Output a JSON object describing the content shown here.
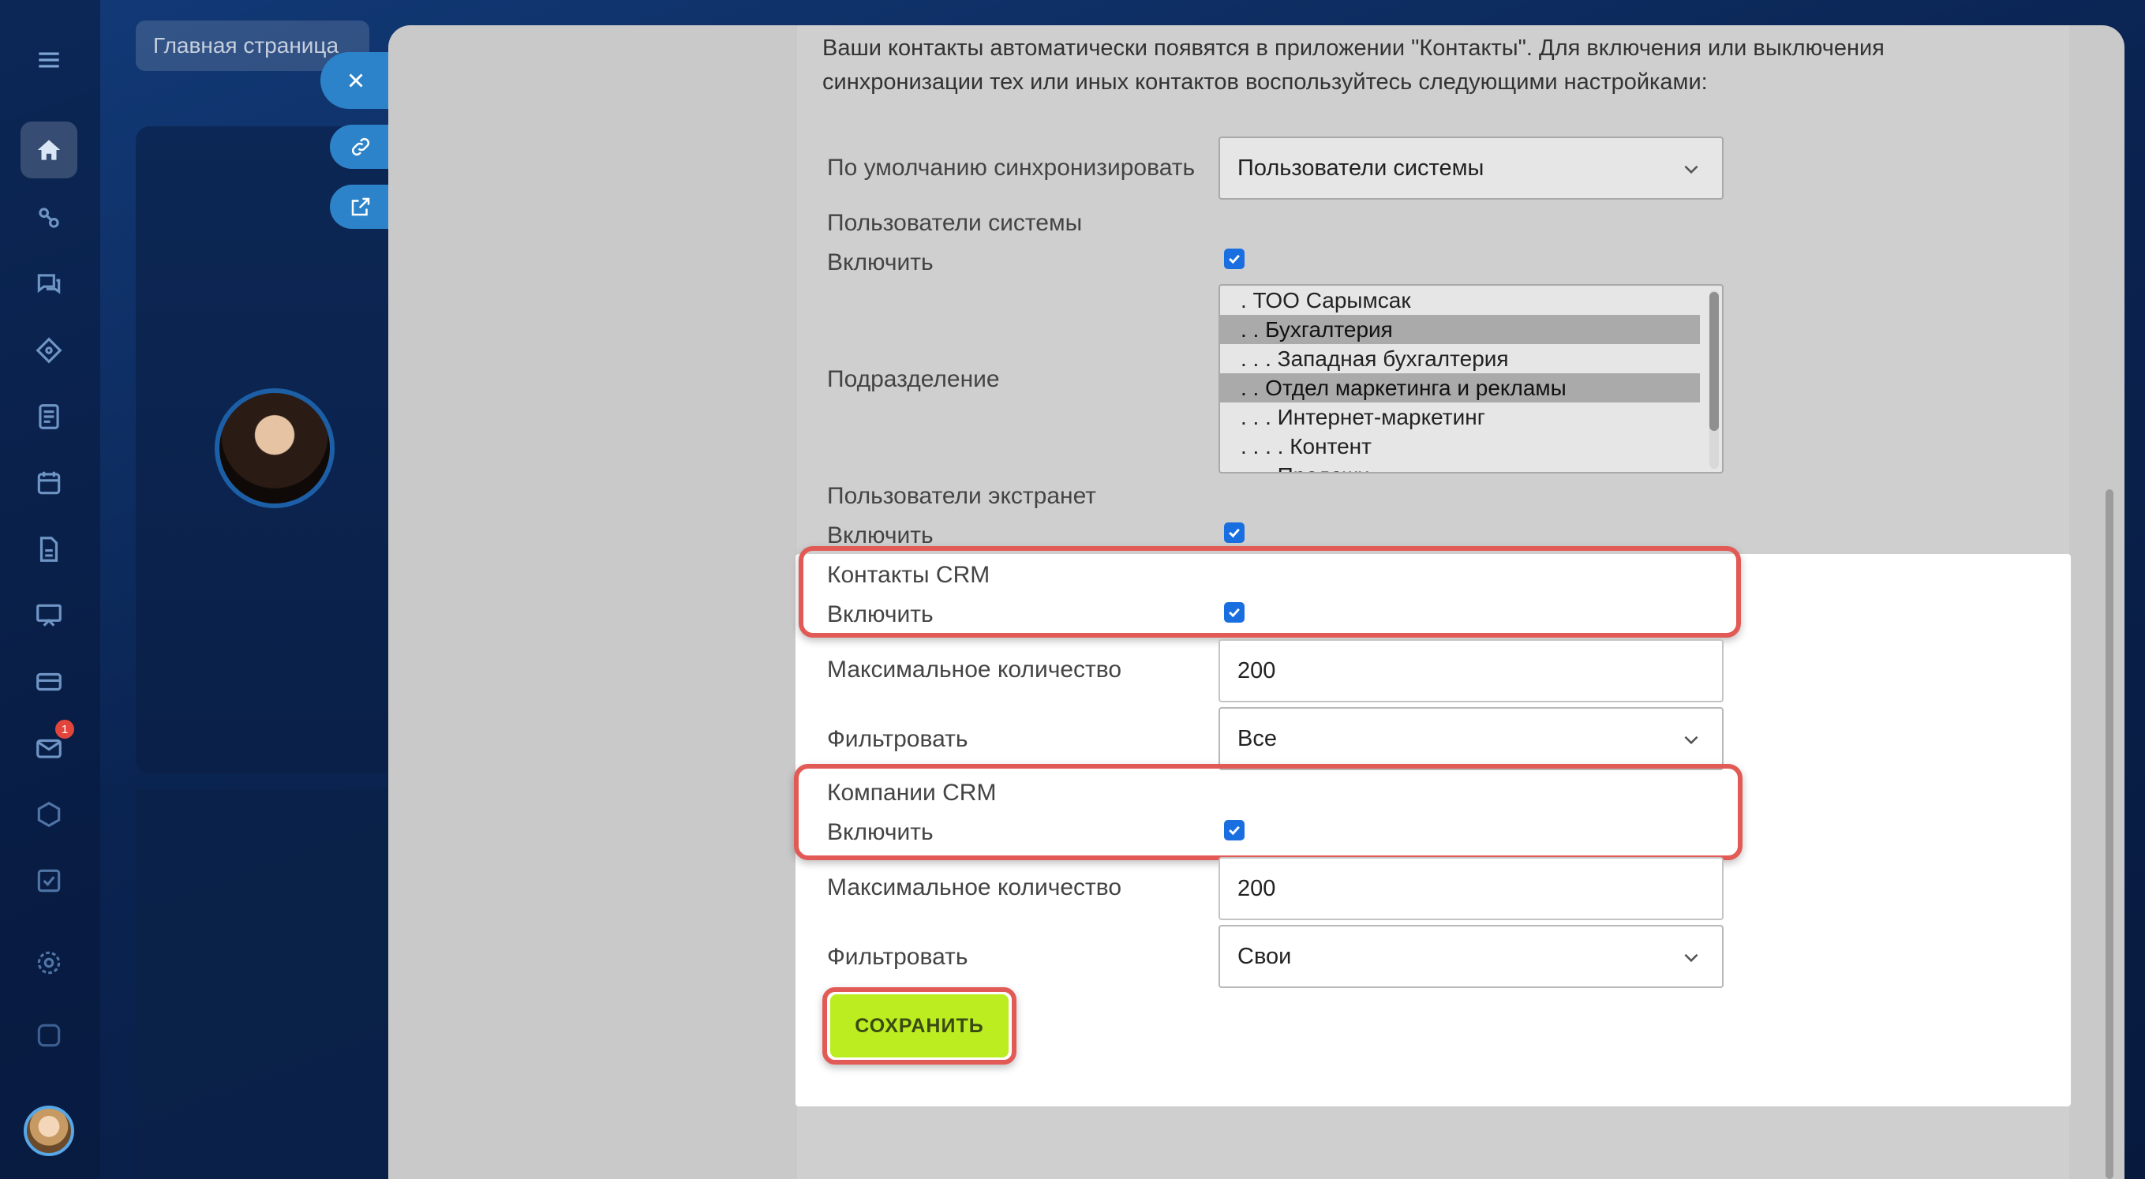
{
  "background": {
    "breadcrumb": "Главная страница",
    "sidebar_badge_count": "1"
  },
  "intro_text": "Ваши контакты автоматически появятся в приложении \"Контакты\". Для включения или выключения синхронизации тех или иных контактов воспользуйтесь следующими настройками:",
  "default_sync": {
    "label": "По умолчанию синхронизировать",
    "value": "Пользователи системы"
  },
  "system_users": {
    "heading": "Пользователи системы",
    "enable_label": "Включить",
    "enabled": true,
    "department_label": "Подразделение",
    "departments": [
      {
        "text": ". ТОО Сарымсак",
        "selected": false
      },
      {
        "text": ". . Бухгалтерия",
        "selected": true
      },
      {
        "text": ". . . Западная бухгалтерия",
        "selected": false
      },
      {
        "text": ". . Отдел маркетинга и рекламы",
        "selected": true
      },
      {
        "text": ". . . Интернет-маркетинг",
        "selected": false
      },
      {
        "text": ". . . . Контент",
        "selected": false
      },
      {
        "text": ". . . Продажи",
        "selected": false
      }
    ]
  },
  "extranet_users": {
    "heading": "Пользователи экстранет",
    "enable_label": "Включить",
    "enabled": true
  },
  "crm_contacts": {
    "heading": "Контакты CRM",
    "enable_label": "Включить",
    "enabled": true,
    "max_label": "Максимальное количество",
    "max_value": "200",
    "filter_label": "Фильтровать",
    "filter_value": "Все"
  },
  "crm_companies": {
    "heading": "Компании CRM",
    "enable_label": "Включить",
    "enabled": true,
    "max_label": "Максимальное количество",
    "max_value": "200",
    "filter_label": "Фильтровать",
    "filter_value": "Свои"
  },
  "save_label": "СОХРАНИТЬ",
  "colors": {
    "accent_checkbox": "#1a6fe0",
    "save_button": "#bbed21",
    "highlight": "#e25a55"
  }
}
